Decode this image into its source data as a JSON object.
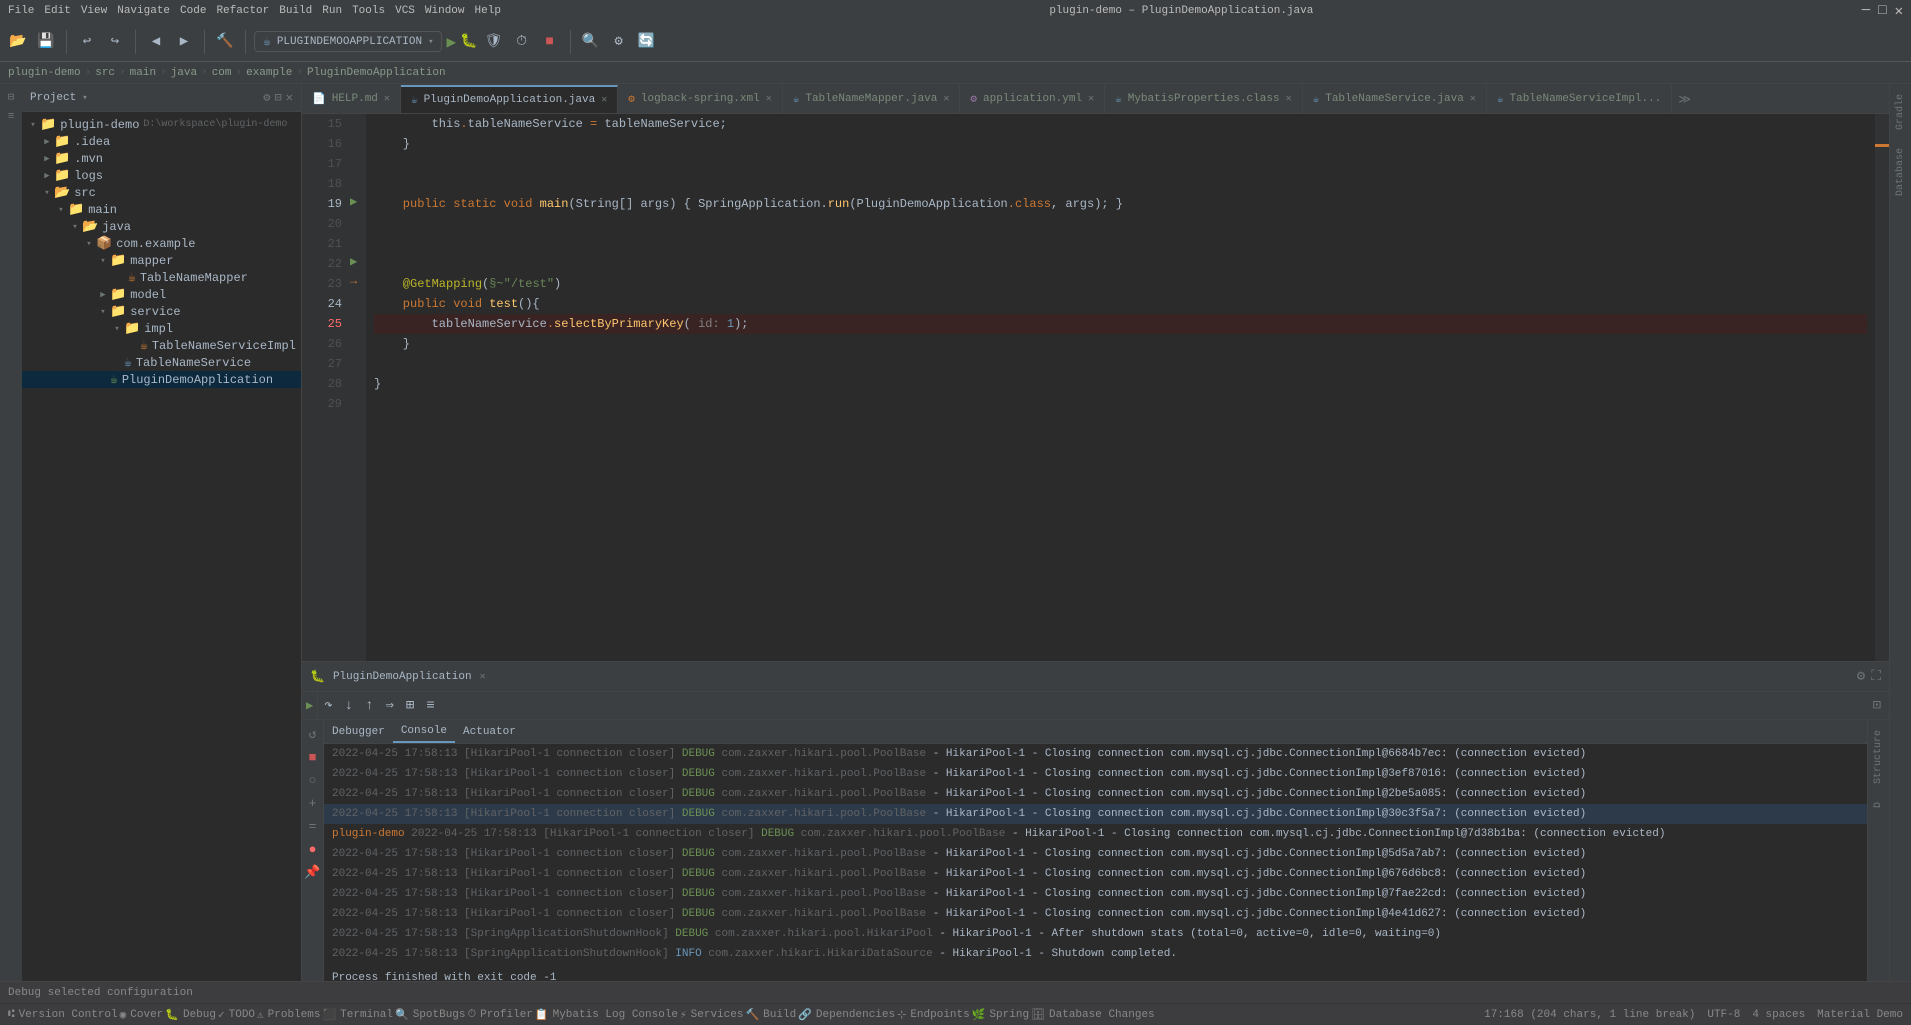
{
  "titlebar": {
    "title": "plugin-demo – PluginDemoApplication.java",
    "menu_items": [
      "File",
      "Edit",
      "View",
      "Navigate",
      "Code",
      "Refactor",
      "Build",
      "Run",
      "Tools",
      "VCS",
      "Window",
      "Help"
    ]
  },
  "toolbar": {
    "run_config": "PLUGINDEMOOAPPLICATION"
  },
  "breadcrumb": {
    "items": [
      "plugin-demo",
      "src",
      "main",
      "java",
      "com",
      "example",
      "PluginDemoApplication"
    ]
  },
  "project_panel": {
    "title": "Project",
    "root": {
      "name": "plugin-demo",
      "path": "D:\\workspace\\plugin-demo",
      "children": [
        {
          "name": ".idea",
          "type": "folder",
          "indent": 1
        },
        {
          "name": ".mvn",
          "type": "folder",
          "indent": 1
        },
        {
          "name": "logs",
          "type": "folder",
          "indent": 1
        },
        {
          "name": "src",
          "type": "src",
          "indent": 1,
          "expanded": true
        },
        {
          "name": "main",
          "type": "folder",
          "indent": 2,
          "expanded": true
        },
        {
          "name": "java",
          "type": "folder",
          "indent": 3,
          "expanded": true
        },
        {
          "name": "com.example",
          "type": "package",
          "indent": 4,
          "expanded": true
        },
        {
          "name": "mapper",
          "type": "folder",
          "indent": 5,
          "expanded": true
        },
        {
          "name": "TableNameMapper",
          "type": "java",
          "indent": 6
        },
        {
          "name": "model",
          "type": "folder",
          "indent": 5
        },
        {
          "name": "service",
          "type": "folder",
          "indent": 5,
          "expanded": true
        },
        {
          "name": "impl",
          "type": "folder",
          "indent": 6,
          "expanded": true
        },
        {
          "name": "TableNameServiceImpl",
          "type": "java",
          "indent": 7
        },
        {
          "name": "TableNameService",
          "type": "java_interface",
          "indent": 6
        },
        {
          "name": "PluginDemoApplication",
          "type": "java_main",
          "indent": 5
        }
      ]
    }
  },
  "tabs": [
    {
      "label": "HELP.md",
      "type": "md",
      "closable": true,
      "active": false
    },
    {
      "label": "PluginDemoApplication.java",
      "type": "java",
      "closable": true,
      "active": true
    },
    {
      "label": "logback-spring.xml",
      "type": "xml",
      "closable": true,
      "active": false
    },
    {
      "label": "TableNameMapper.java",
      "type": "java",
      "closable": true,
      "active": false
    },
    {
      "label": "application.yml",
      "type": "yml",
      "closable": true,
      "active": false
    },
    {
      "label": "MybatisProperties.class",
      "type": "class",
      "closable": true,
      "active": false
    },
    {
      "label": "TableNameService.java",
      "type": "java",
      "closable": true,
      "active": false
    },
    {
      "label": "TableNameServiceImpl...",
      "type": "java",
      "closable": false,
      "active": false
    }
  ],
  "code": {
    "lines": [
      {
        "num": 15,
        "content": "        this.tableNameService = tableNameService;"
      },
      {
        "num": 16,
        "content": "    }"
      },
      {
        "num": 17,
        "content": ""
      },
      {
        "num": 18,
        "content": ""
      },
      {
        "num": 19,
        "content": "    public static void main(String[] args) { SpringApplication.run(PluginDemoApplication.class, args); }"
      },
      {
        "num": 20,
        "content": ""
      },
      {
        "num": 21,
        "content": ""
      },
      {
        "num": 22,
        "content": ""
      },
      {
        "num": 23,
        "content": "    @GetMapping(\"\\u00a7~\\\"/test\\\")"
      },
      {
        "num": 24,
        "content": "    public void test(){"
      },
      {
        "num": 25,
        "content": "        tableNameService.selectByPrimaryKey( id: 1);"
      },
      {
        "num": 26,
        "content": "    }"
      },
      {
        "num": 27,
        "content": ""
      },
      {
        "num": 28,
        "content": "}"
      },
      {
        "num": 29,
        "content": ""
      }
    ]
  },
  "debug": {
    "title": "PluginDemoApplication",
    "tabs": [
      "Debugger",
      "Console",
      "Actuator"
    ],
    "active_tab": "Console",
    "console_lines": [
      {
        "timestamp": "2022-04-25 17:58:13",
        "thread": "[HikariPool-1 connection closer]",
        "level": "DEBUG",
        "logger": "com.zaxxer.hikari.pool.PoolBase",
        "msg": "- HikariPool-1 - Closing connection com.mysql.cj.jdbc.ConnectionImpl@6684b7ec: (connection evicted)"
      },
      {
        "timestamp": "2022-04-25 17:58:13",
        "thread": "[HikariPool-1 connection closer]",
        "level": "DEBUG",
        "logger": "com.zaxxer.hikari.pool.PoolBase",
        "msg": "- HikariPool-1 - Closing connection com.mysql.cj.jdbc.ConnectionImpl@3ef87016: (connection evicted)"
      },
      {
        "timestamp": "2022-04-25 17:58:13",
        "thread": "[HikariPool-1 connection closer]",
        "level": "DEBUG",
        "logger": "com.zaxxer.hikari.pool.PoolBase",
        "msg": "- HikariPool-1 - Closing connection com.mysql.cj.jdbc.ConnectionImpl@2be5a085: (connection evicted)"
      },
      {
        "timestamp": "2022-04-25 17:58:13",
        "thread": "[HikariPool-1 connection closer]",
        "level": "DEBUG",
        "logger": "com.zaxxer.hikari.pool.PoolBase",
        "msg": "- HikariPool-1 - Closing connection com.mysql.cj.jdbc.ConnectionImpl@30c3f5a7: (connection evicted)",
        "selected": true
      },
      {
        "timestamp": "2022-04-25 17:58:13",
        "thread": "[HikariPool-1 connection closer]",
        "level": "DEBUG",
        "logger": "com.zaxxer.hikari.pool.PoolBase",
        "msg": "- HikariPool-1 - Closing connection com.mysql.cj.jdbc.ConnectionImpl@7d38b1ba: (connection evicted)",
        "marker": "plugin-demo"
      },
      {
        "timestamp": "2022-04-25 17:58:13",
        "thread": "[HikariPool-1 connection closer]",
        "level": "DEBUG",
        "logger": "com.zaxxer.hikari.pool.PoolBase",
        "msg": "- HikariPool-1 - Closing connection com.mysql.cj.jdbc.ConnectionImpl@5d5a7ab7: (connection evicted)"
      },
      {
        "timestamp": "2022-04-25 17:58:13",
        "thread": "[HikariPool-1 connection closer]",
        "level": "DEBUG",
        "logger": "com.zaxxer.hikari.pool.PoolBase",
        "msg": "- HikariPool-1 - Closing connection com.mysql.cj.jdbc.ConnectionImpl@676d6bc8: (connection evicted)"
      },
      {
        "timestamp": "2022-04-25 17:58:13",
        "thread": "[HikariPool-1 connection closer]",
        "level": "DEBUG",
        "logger": "com.zaxxer.hikari.pool.PoolBase",
        "msg": "- HikariPool-1 - Closing connection com.mysql.cj.jdbc.ConnectionImpl@7fae22cd: (connection evicted)"
      },
      {
        "timestamp": "2022-04-25 17:58:13",
        "thread": "[HikariPool-1 connection closer]",
        "level": "DEBUG",
        "logger": "com.zaxxer.hikari.pool.PoolBase",
        "msg": "- HikariPool-1 - Closing connection com.mysql.cj.jdbc.ConnectionImpl@4e41d627: (connection evicted)"
      },
      {
        "timestamp": "2022-04-25 17:58:13",
        "thread": "[SpringApplicationShutdownHook]",
        "level": "DEBUG",
        "logger": "com.zaxxer.hikari.pool.HikariPool",
        "msg": "- HikariPool-1 - After shutdown stats (total=0, active=0, idle=0, waiting=0)"
      },
      {
        "timestamp": "2022-04-25 17:58:13",
        "thread": "[SpringApplicationShutdownHook]",
        "level": "INFO",
        "logger": "com.zaxxer.hikari.HikariDataSource",
        "msg": "- HikariPool-1 - Shutdown completed."
      }
    ],
    "exit_message": "Process finished with exit code -1"
  },
  "status_bar": {
    "left": "Debug selected configuration",
    "items": [
      {
        "label": "Version Control",
        "icon": "git"
      },
      {
        "label": "Cover",
        "icon": "cover"
      },
      {
        "label": "Debug",
        "icon": "debug"
      },
      {
        "label": "TODO",
        "icon": "todo"
      },
      {
        "label": "Problems",
        "icon": "problems"
      },
      {
        "label": "Terminal",
        "icon": "terminal"
      },
      {
        "label": "SpotBugs",
        "icon": "spotbugs"
      },
      {
        "label": "Profiler",
        "icon": "profiler"
      },
      {
        "label": "Mybatis Log Console",
        "icon": "mybatis"
      },
      {
        "label": "Services",
        "icon": "services"
      },
      {
        "label": "Build",
        "icon": "build"
      },
      {
        "label": "Dependencies",
        "icon": "deps"
      },
      {
        "label": "Endpoints",
        "icon": "endpoints"
      },
      {
        "label": "Spring",
        "icon": "spring"
      },
      {
        "label": "Database Changes",
        "icon": "db"
      }
    ],
    "right": {
      "position": "17:168 (204 chars, 1 line break)",
      "encoding": "UTF-8",
      "indent": "4 spaces",
      "theme": "Material Demo"
    }
  }
}
